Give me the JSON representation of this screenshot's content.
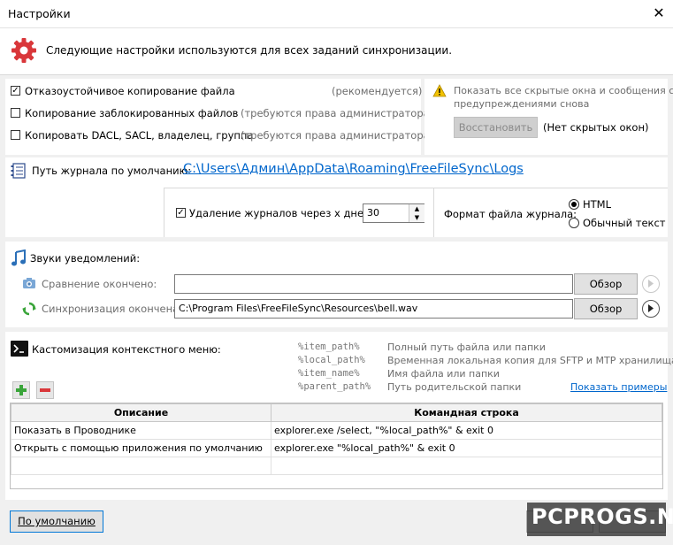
{
  "window": {
    "title": "Настройки"
  },
  "header": {
    "text": "Следующие настройки используются для всех заданий синхронизации."
  },
  "options": [
    {
      "label": "Отказоустойчивое копирование файла",
      "hint": "(рекомендуется)",
      "checked": true
    },
    {
      "label": "Копирование заблокированных файлов",
      "hint": "(требуются права администратора)",
      "checked": false
    },
    {
      "label": "Копировать DACL, SACL, владелец, группа",
      "hint": "(требуются права администратора)",
      "checked": false
    }
  ],
  "hidden_windows": {
    "text_line1": "Показать все скрытые окна и сообщения с",
    "text_line2": "предупреждениями снова",
    "restore_label": "Восстановить",
    "status": "(Нет скрытых окон)"
  },
  "log": {
    "path_label": "Путь журнала по умолчанию:",
    "path": "C:\\Users\\Админ\\AppData\\Roaming\\FreeFileSync\\Logs",
    "delete_label": "Удаление журналов через x дней:",
    "delete_checked": true,
    "days": "30",
    "format_label": "Формат файла журнала:",
    "formats": [
      "HTML",
      "Обычный текст"
    ],
    "format_selected": "HTML"
  },
  "sounds": {
    "title": "Звуки уведомлений:",
    "items": [
      {
        "label": "Сравнение окончено:",
        "value": "",
        "browse": "Обзор"
      },
      {
        "label": "Синхронизация окончена:",
        "value": "C:\\Program Files\\FreeFileSync\\Resources\\bell.wav",
        "browse": "Обзор"
      }
    ]
  },
  "context_menu": {
    "title": "Кастомизация контекстного меню:",
    "macros": [
      {
        "name": "%item_path%",
        "desc": "Полный путь файла или папки"
      },
      {
        "name": "%local_path%",
        "desc": "Временная локальная копия для SFTP и MTP хранилища"
      },
      {
        "name": "%item_name%",
        "desc": "Имя файла или папки"
      },
      {
        "name": "%parent_path%",
        "desc": "Путь родительской папки"
      }
    ],
    "examples_link": "Показать примеры",
    "columns": [
      "Описание",
      "Командная строка"
    ],
    "rows": [
      {
        "desc": "Показать в Проводнике",
        "cmd": "explorer.exe /select, \"%local_path%\" & exit 0"
      },
      {
        "desc": "Открыть с помощью приложения по умолчанию",
        "cmd": "explorer.exe \"%local_path%\" & exit 0"
      }
    ]
  },
  "footer": {
    "default_label": "По умолчанию",
    "watermark": "PCPROGS.NET"
  },
  "icons": {
    "gear": "gear-icon",
    "warning": "warning-icon",
    "log": "log-icon",
    "music": "music-note-icon",
    "camera": "camera-icon",
    "sync": "sync-icon",
    "terminal": "terminal-icon",
    "add": "add-icon",
    "remove": "remove-icon",
    "play": "play-icon",
    "close": "close-icon"
  },
  "colors": {
    "accent_red": "#d9373a",
    "link": "#0066cc",
    "add_green": "#3aa53a"
  }
}
